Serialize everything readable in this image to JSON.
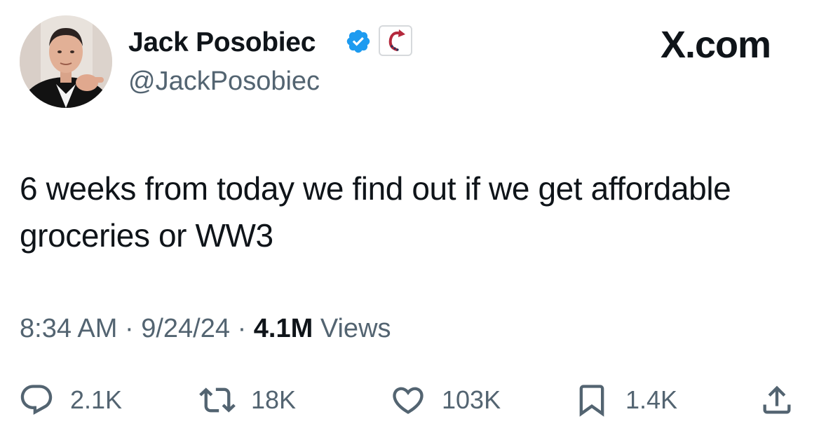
{
  "author": {
    "display_name": "Jack Posobiec",
    "handle": "@JackPosobiec",
    "verified": true,
    "avatar_icon": "profile-photo",
    "affiliation_icon": "curved-arrow-badge-icon"
  },
  "brand": {
    "label": "X.com"
  },
  "tweet": {
    "text": "6 weeks from today we find out if we get affordable groceries or WW3"
  },
  "meta": {
    "time": "8:34 AM",
    "sep1": "·",
    "date": "9/24/24",
    "sep2": "·",
    "views_count": "4.1M",
    "views_label": "Views"
  },
  "actions": {
    "replies": "2.1K",
    "reposts": "18K",
    "likes": "103K",
    "bookmarks": "1.4K"
  },
  "colors": {
    "text_primary": "#0f1419",
    "text_secondary": "#536471",
    "verified_blue": "#1d9bf0"
  }
}
